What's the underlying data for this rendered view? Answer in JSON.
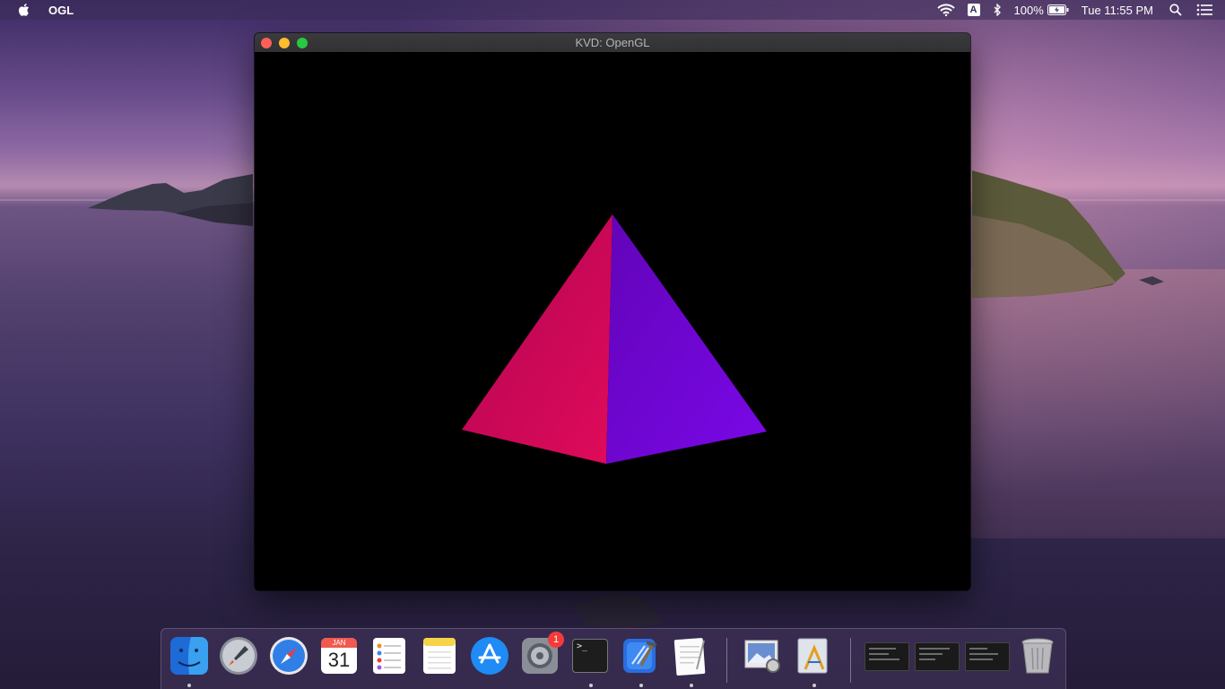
{
  "menubar": {
    "app_name": "OGL",
    "input_source": "A",
    "battery": "100%",
    "clock": "Tue 11:55 PM"
  },
  "window": {
    "title": "KVD: OpenGL"
  },
  "dock": {
    "calendar_month": "JAN",
    "calendar_day": "31",
    "system_prefs_badge": "1",
    "terminal_prompt": ">_"
  },
  "scene": {
    "left_face_colors": [
      "#c4074f",
      "#e00a5a"
    ],
    "right_face_colors": [
      "#6a04c8",
      "#7a08e8"
    ]
  }
}
